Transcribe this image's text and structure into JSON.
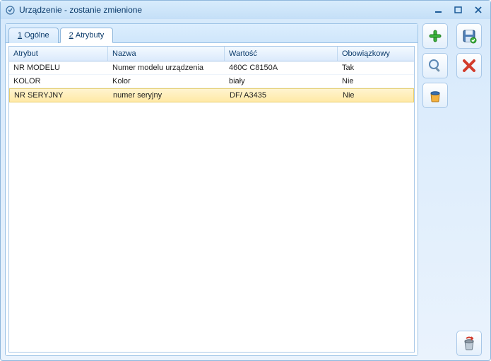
{
  "window": {
    "title": "Urządzenie - zostanie zmienione"
  },
  "tabs": [
    {
      "hotkey": "1",
      "label": "Ogólne",
      "active": false
    },
    {
      "hotkey": "2",
      "label": "Atrybuty",
      "active": true
    }
  ],
  "grid": {
    "columns": {
      "attribute": "Atrybut",
      "name": "Nazwa",
      "value": "Wartość",
      "required": "Obowiązkowy"
    },
    "rows": [
      {
        "attribute": "NR MODELU",
        "name": "Numer modelu urządzenia",
        "value": "460C C8150A",
        "required": "Tak",
        "selected": false
      },
      {
        "attribute": "KOLOR",
        "name": "Kolor",
        "value": "biały",
        "required": "Nie",
        "selected": false
      },
      {
        "attribute": "NR SERYJNY",
        "name": "numer seryjny",
        "value": "DF/ A3435",
        "required": "Nie",
        "selected": true
      }
    ]
  },
  "buttons": {
    "add": "add",
    "find": "find",
    "bin": "bin",
    "save": "save",
    "close": "close",
    "exit": "exit"
  }
}
